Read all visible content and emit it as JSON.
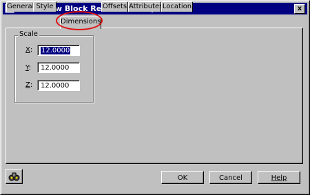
{
  "window": {
    "title": "Multi-View Block Reference Properties",
    "close_label": "x"
  },
  "tabs": [
    {
      "label": "General"
    },
    {
      "label": "Style"
    },
    {
      "label": "Dimensions",
      "active": true
    },
    {
      "label": "Offsets"
    },
    {
      "label": "Attributes"
    },
    {
      "label": "Location"
    }
  ],
  "scale": {
    "group_label": "Scale",
    "x_label": "X",
    "x_value": "12.0000",
    "y_label": "Y",
    "y_value": "12.0000",
    "z_label": "Z",
    "z_value": "12.0000"
  },
  "buttons": {
    "ok": "OK",
    "cancel": "Cancel",
    "help": "Help"
  },
  "colors": {
    "titlebar": "#000080",
    "face": "#c0c0c0",
    "highlight_circle": "#e01010"
  }
}
